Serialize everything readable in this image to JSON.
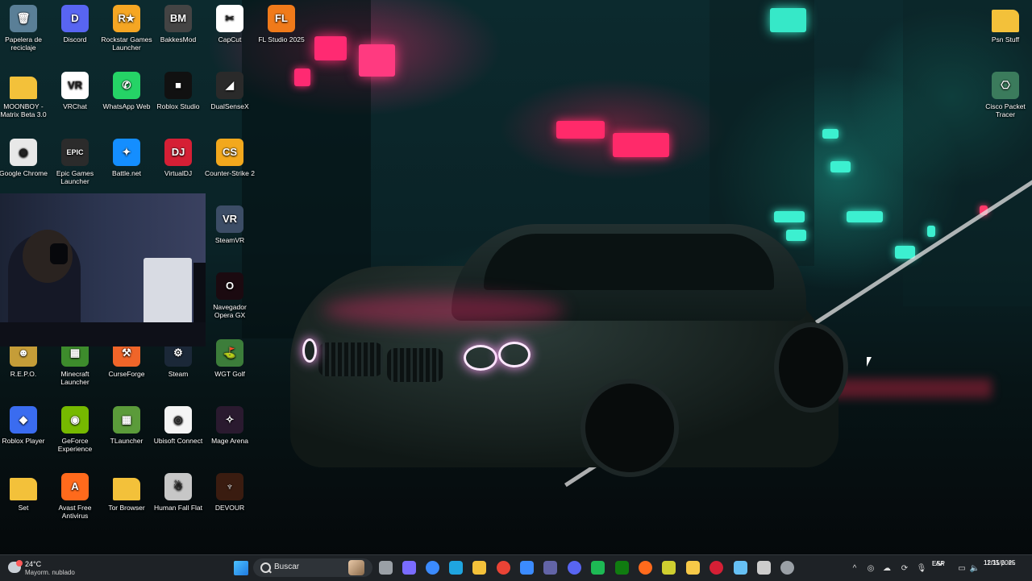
{
  "desktop": {
    "icons": [
      {
        "label": "Papelera de reciclaje",
        "icon": "recycle-bin-icon",
        "bg": "#5a7f97",
        "glyph": "🗑"
      },
      {
        "label": "Discord",
        "icon": "discord-icon",
        "bg": "#5865f2",
        "glyph": "D"
      },
      {
        "label": "Rockstar Games Launcher",
        "icon": "rockstar-icon",
        "bg": "#f5a623",
        "glyph": "R★"
      },
      {
        "label": "BakkesMod",
        "icon": "bakkesmod-icon",
        "bg": "#444444",
        "glyph": "BM"
      },
      {
        "label": "CapCut",
        "icon": "capcut-icon",
        "bg": "#ffffff",
        "glyph": "✂"
      },
      {
        "label": "FL Studio 2025",
        "icon": "fl-studio-icon",
        "bg": "#f07a1a",
        "glyph": "FL"
      },
      {
        "label": "Psn Stuff",
        "icon": "folder-icon",
        "bg": "#f3c13a",
        "glyph": ""
      },
      {
        "label": "MOONBOY - Matrix Beta 3.0",
        "icon": "folder-icon",
        "bg": "#f3c13a",
        "glyph": ""
      },
      {
        "label": "VRChat",
        "icon": "vrchat-icon",
        "bg": "#ffffff",
        "glyph": "VR"
      },
      {
        "label": "WhatsApp Web",
        "icon": "whatsapp-icon",
        "bg": "#25d366",
        "glyph": "✆"
      },
      {
        "label": "Roblox Studio",
        "icon": "roblox-studio-icon",
        "bg": "#111111",
        "glyph": "■"
      },
      {
        "label": "DualSenseX",
        "icon": "dualsensex-icon",
        "bg": "#2a2a2a",
        "glyph": "◢"
      },
      {
        "label": "Cisco Packet Tracer",
        "icon": "cisco-packet-tracer-icon",
        "bg": "#3b7b5c",
        "glyph": "⎔"
      },
      {
        "label": "Google Chrome",
        "icon": "chrome-icon",
        "bg": "#e8e8e8",
        "glyph": "◉"
      },
      {
        "label": "Epic Games Launcher",
        "icon": "epic-games-icon",
        "bg": "#2b2b2b",
        "glyph": "EPIC"
      },
      {
        "label": "Battle.net",
        "icon": "battlenet-icon",
        "bg": "#148eff",
        "glyph": "✦"
      },
      {
        "label": "VirtualDJ",
        "icon": "virtualdj-icon",
        "bg": "#d51f35",
        "glyph": "DJ"
      },
      {
        "label": "Counter-Strike 2",
        "icon": "cs2-icon",
        "bg": "#f2a81d",
        "glyph": "CS"
      },
      {
        "label": "SteamVR",
        "icon": "steamvr-icon",
        "bg": "#3c4d66",
        "glyph": "VR"
      },
      {
        "label": "Navegador Opera GX",
        "icon": "opera-gx-icon",
        "bg": "#1b0a10",
        "glyph": "O"
      },
      {
        "label": "R.E.P.O.",
        "icon": "repo-icon",
        "bg": "#c59d38",
        "glyph": "☻"
      },
      {
        "label": "Minecraft Launcher",
        "icon": "minecraft-icon",
        "bg": "#3d8c2c",
        "glyph": "▦"
      },
      {
        "label": "CurseForge",
        "icon": "curseforge-icon",
        "bg": "#f06529",
        "glyph": "⚒"
      },
      {
        "label": "Steam",
        "icon": "steam-icon",
        "bg": "#1b2838",
        "glyph": "⚙"
      },
      {
        "label": "WGT Golf",
        "icon": "wgt-golf-icon",
        "bg": "#3c7d3a",
        "glyph": "⛳"
      },
      {
        "label": "Roblox Player",
        "icon": "roblox-player-icon",
        "bg": "#3a6cf0",
        "glyph": "◆"
      },
      {
        "label": "GeForce Experience",
        "icon": "geforce-icon",
        "bg": "#76b900",
        "glyph": "◉"
      },
      {
        "label": "TLauncher",
        "icon": "tlauncher-icon",
        "bg": "#5b9b3a",
        "glyph": "▦"
      },
      {
        "label": "Ubisoft Connect",
        "icon": "ubisoft-icon",
        "bg": "#f4f4f4",
        "glyph": "◎"
      },
      {
        "label": "Mage Arena",
        "icon": "mage-arena-icon",
        "bg": "#2a1a2f",
        "glyph": "✧"
      },
      {
        "label": "Set",
        "icon": "folder-icon",
        "bg": "#f3c13a",
        "glyph": ""
      },
      {
        "label": "Avast Free Antivirus",
        "icon": "avast-icon",
        "bg": "#ff6a1c",
        "glyph": "A"
      },
      {
        "label": "Tor Browser",
        "icon": "folder-icon",
        "bg": "#f3c13a",
        "glyph": ""
      },
      {
        "label": "Human Fall Flat",
        "icon": "human-fall-flat-icon",
        "bg": "#c7c7c7",
        "glyph": "☃"
      },
      {
        "label": "DEVOUR",
        "icon": "devour-icon",
        "bg": "#3a1c10",
        "glyph": "♆"
      }
    ]
  },
  "taskbar": {
    "weather": {
      "temp": "24°C",
      "desc": "Mayorm. nublado"
    },
    "search_placeholder": "Buscar",
    "apps": [
      {
        "icon": "start-icon",
        "color": "#4cc2ff"
      },
      {
        "icon": "task-view-icon",
        "color": "#9aa0a6"
      },
      {
        "icon": "copilot-icon",
        "color": "#7a6cff"
      },
      {
        "icon": "widgets-icon",
        "color": "#3b8bff"
      },
      {
        "icon": "edge-icon",
        "color": "#1fa5e0"
      },
      {
        "icon": "file-explorer-icon",
        "color": "#f3c13a"
      },
      {
        "icon": "chrome-icon",
        "color": "#ea4335"
      },
      {
        "icon": "store-icon",
        "color": "#3b8bff"
      },
      {
        "icon": "teams-icon",
        "color": "#6264a7"
      },
      {
        "icon": "discord-icon",
        "color": "#5865f2"
      },
      {
        "icon": "spotify-icon",
        "color": "#1db954"
      },
      {
        "icon": "xbox-icon",
        "color": "#107c10"
      },
      {
        "icon": "avast-icon",
        "color": "#ff6a1c"
      },
      {
        "icon": "opera-icon",
        "color": "#cfcf30"
      },
      {
        "icon": "dot-icon",
        "color": "#f7c948"
      },
      {
        "icon": "winrar-icon",
        "color": "#d51f35"
      },
      {
        "icon": "steam-icon",
        "color": "#66c0f4"
      },
      {
        "icon": "obs-icon",
        "color": "#cccccc"
      },
      {
        "icon": "settings-icon",
        "color": "#9aa0a6"
      }
    ],
    "language": {
      "line1": "ESP",
      "line2": "LAA"
    },
    "clock": {
      "time": "11:35 p. m.",
      "date": "12/11/2025"
    }
  }
}
